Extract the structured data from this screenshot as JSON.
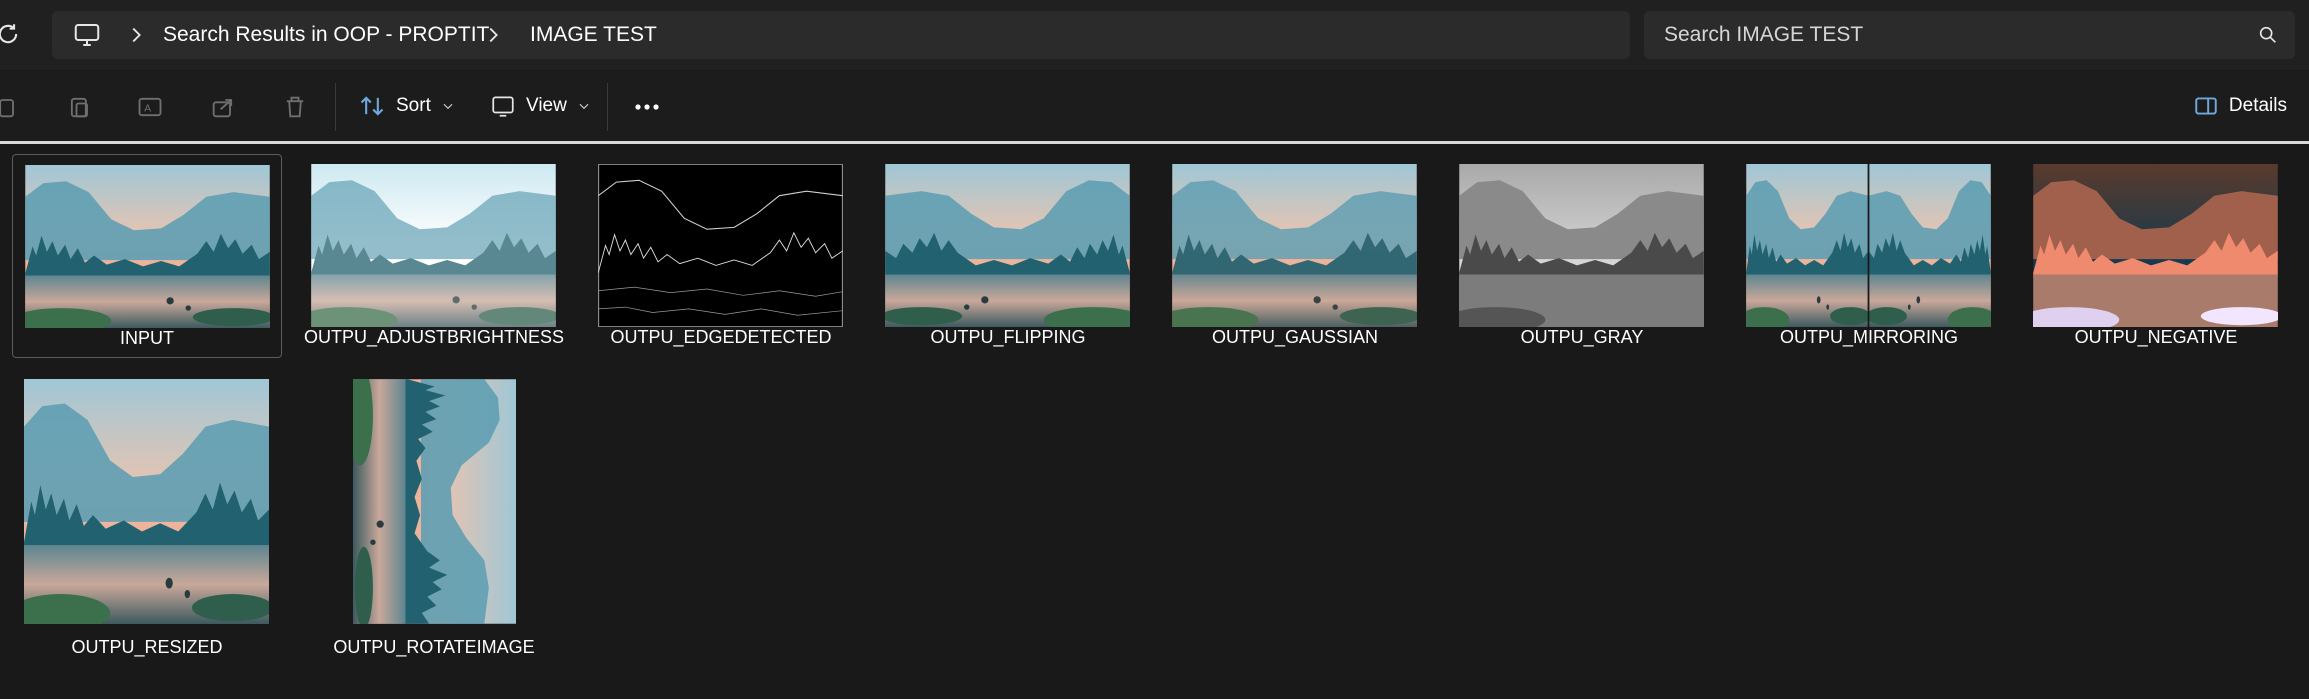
{
  "address_bar": {
    "crumbs": [
      "Search Results in OOP - PROPTIT",
      "IMAGE TEST"
    ],
    "search_placeholder": "Search IMAGE TEST"
  },
  "toolbar": {
    "sort_label": "Sort",
    "view_label": "View",
    "details_label": "Details"
  },
  "files": [
    {
      "name": "INPUT",
      "variant": "normal",
      "selected": true
    },
    {
      "name": "OUTPU_ADJUSTBRIGHTNESS",
      "variant": "bright"
    },
    {
      "name": "OUTPU_EDGEDETECTED",
      "variant": "edge"
    },
    {
      "name": "OUTPU_FLIPPING",
      "variant": "normal"
    },
    {
      "name": "OUTPU_GAUSSIAN",
      "variant": "normal"
    },
    {
      "name": "OUTPU_GRAY",
      "variant": "gray"
    },
    {
      "name": "OUTPU_MIRRORING",
      "variant": "mirror"
    },
    {
      "name": "OUTPU_NEGATIVE",
      "variant": "negative"
    },
    {
      "name": "OUTPU_RESIZED",
      "variant": "square"
    },
    {
      "name": "OUTPU_ROTATEIMAGE",
      "variant": "rotated"
    }
  ]
}
